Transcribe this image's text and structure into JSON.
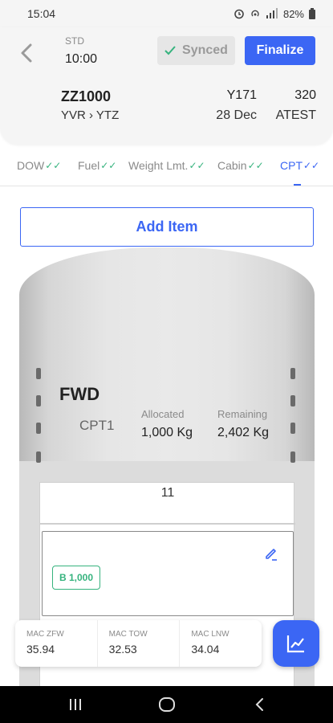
{
  "status_bar": {
    "time": "15:04",
    "battery": "82%"
  },
  "header": {
    "std_label": "STD",
    "std_value": "10:00",
    "synced_label": "Synced",
    "finalize_label": "Finalize",
    "flight_number": "ZZ1000",
    "route": "YVR › YTZ",
    "registration": "Y171",
    "date": "28 Dec",
    "aircraft_type": "320",
    "config": "ATEST"
  },
  "tabs": [
    {
      "label": "DOW"
    },
    {
      "label": "Fuel"
    },
    {
      "label": "Weight Lmt."
    },
    {
      "label": "Cabin"
    },
    {
      "label": "CPT"
    }
  ],
  "check_glyph": "✓✓",
  "add_item_label": "Add Item",
  "compartment": {
    "section": "FWD",
    "name": "CPT1",
    "allocated_label": "Allocated",
    "allocated_value": "1,000 Kg",
    "remaining_label": "Remaining",
    "remaining_value": "2,402 Kg"
  },
  "hold": {
    "number": "11",
    "badge": "B 1,000"
  },
  "mac": [
    {
      "label": "MAC ZFW",
      "value": "35.94"
    },
    {
      "label": "MAC TOW",
      "value": "32.53"
    },
    {
      "label": "MAC LNW",
      "value": "34.04"
    }
  ],
  "colors": {
    "accent": "#3b66f4",
    "success": "#36b37e"
  }
}
